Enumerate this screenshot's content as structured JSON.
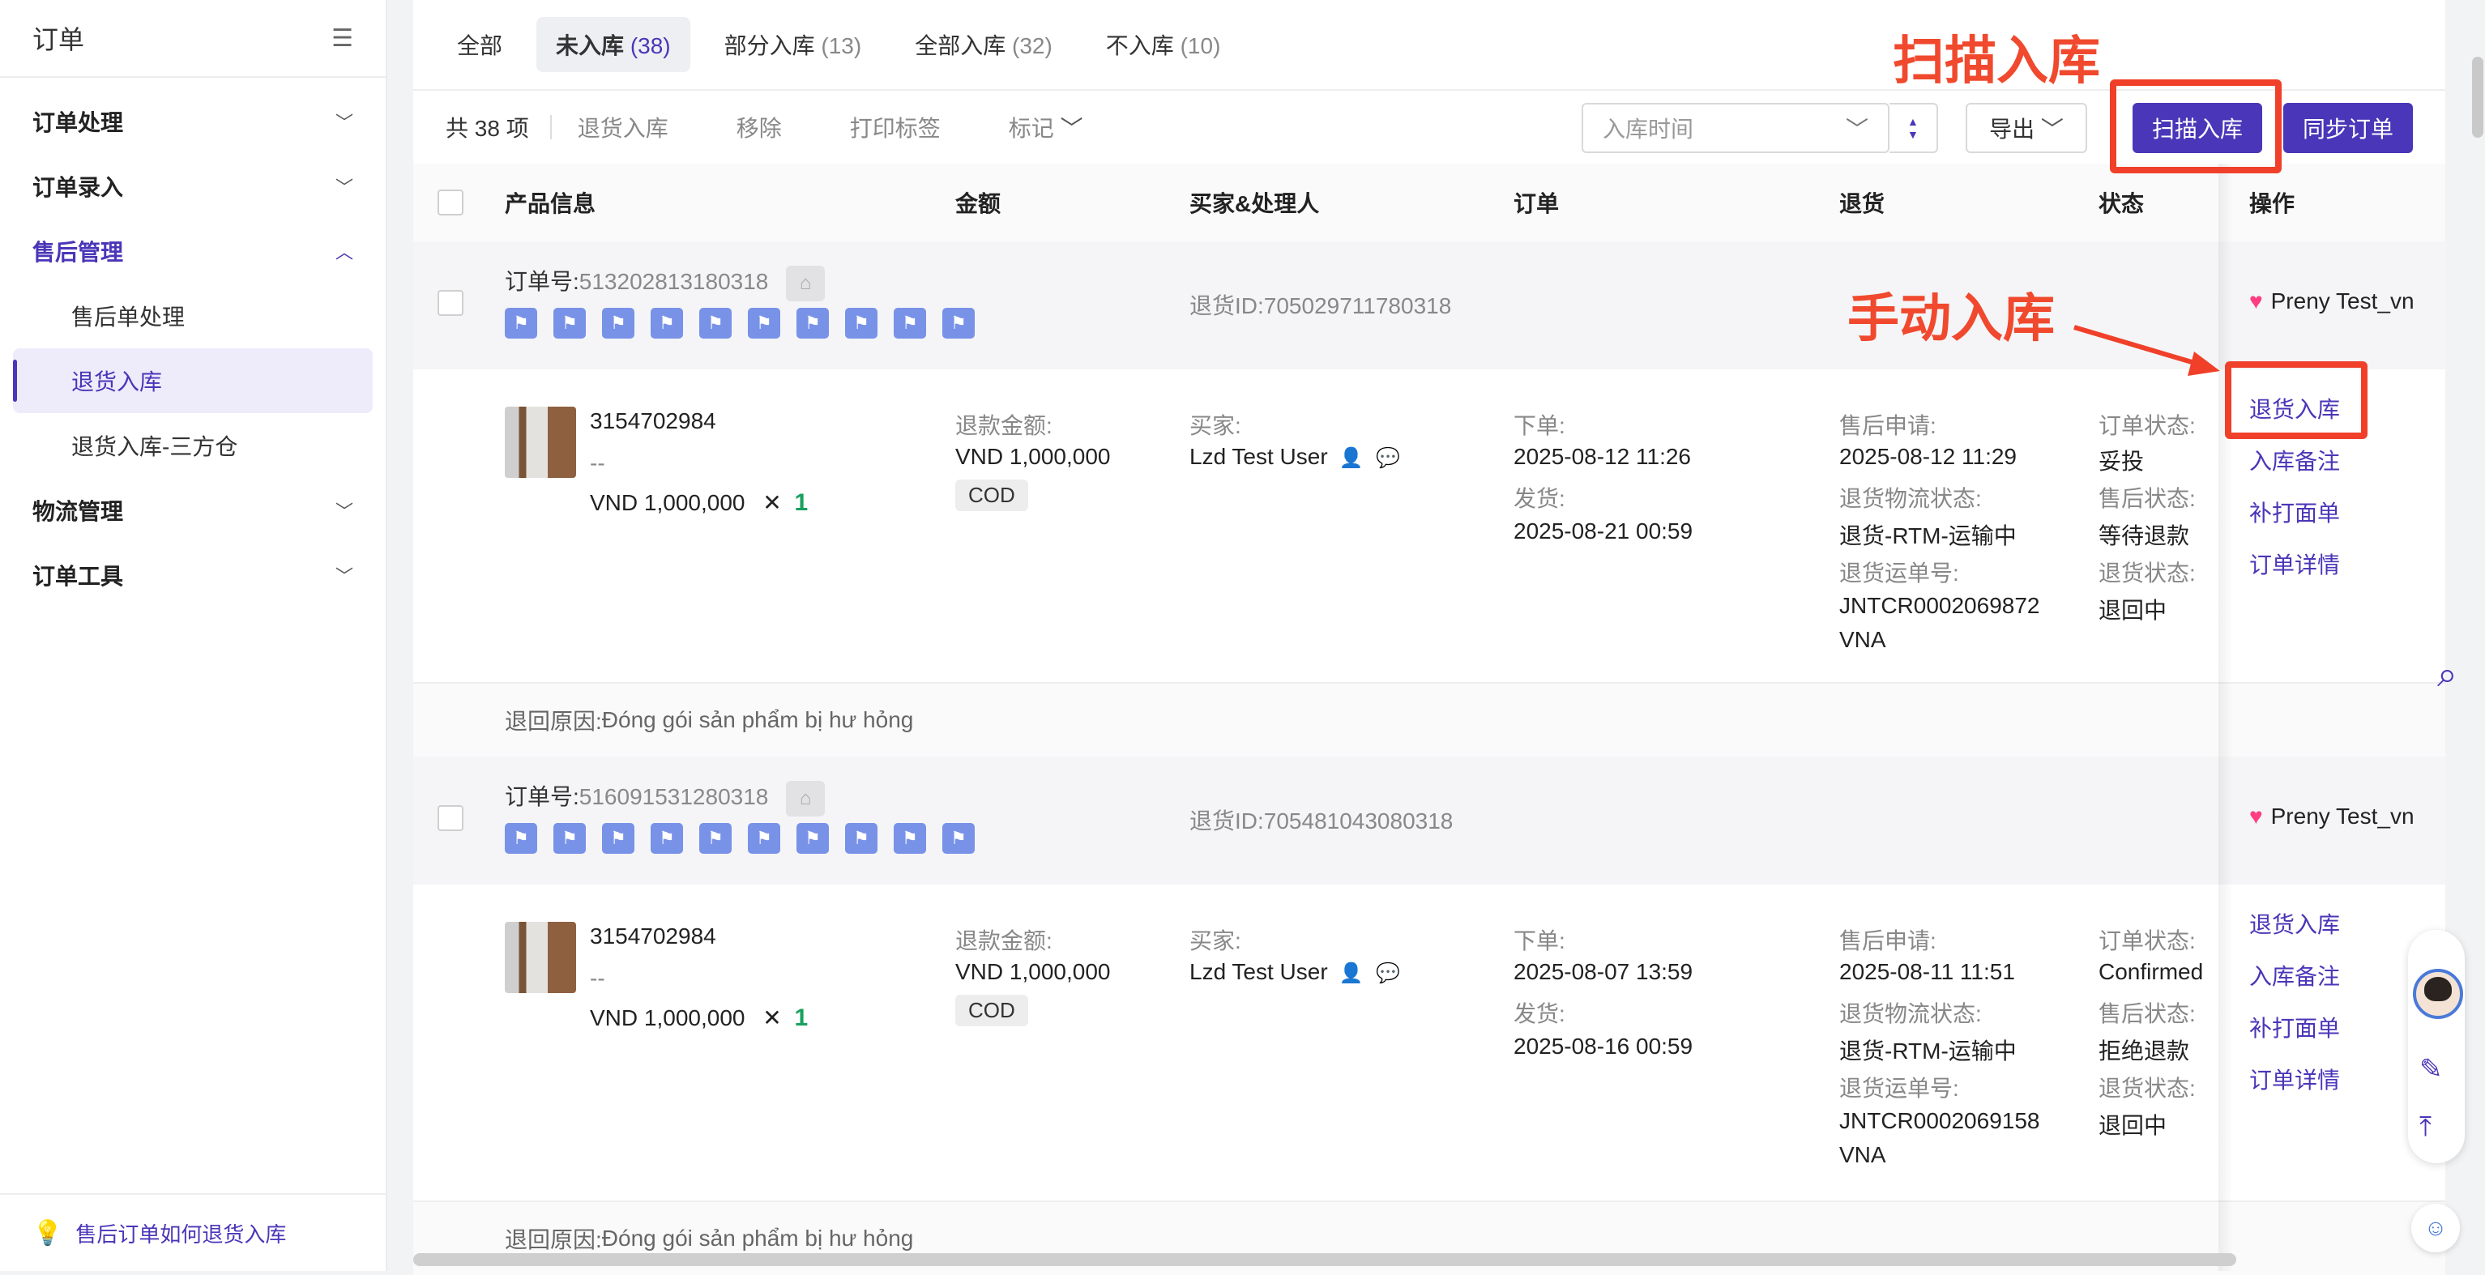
{
  "sidebar": {
    "title": "订单",
    "groups": [
      {
        "label": "订单处理"
      },
      {
        "label": "订单录入"
      },
      {
        "label": "售后管理"
      },
      {
        "label": "物流管理"
      },
      {
        "label": "订单工具"
      }
    ],
    "sub_items": [
      {
        "label": "售后单处理"
      },
      {
        "label": "退货入库"
      },
      {
        "label": "退货入库-三方仓"
      }
    ],
    "footer_link": "售后订单如何退货入库"
  },
  "tabs": [
    {
      "label": "全部",
      "count": ""
    },
    {
      "label": "未入库",
      "count": "(38)"
    },
    {
      "label": "部分入库",
      "count": "(13)"
    },
    {
      "label": "全部入库",
      "count": "(32)"
    },
    {
      "label": "不入库",
      "count": "(10)"
    }
  ],
  "toolbar": {
    "total": "共 38 项",
    "return_in": "退货入库",
    "remove": "移除",
    "print_label": "打印标签",
    "mark": "标记",
    "time_select": "入库时间",
    "export": "导出",
    "scan_in": "扫描入库",
    "sync": "同步订单"
  },
  "columns": {
    "product": "产品信息",
    "amount": "金额",
    "buyer": "买家&处理人",
    "order": "订单",
    "return": "退货",
    "status": "状态",
    "action": "操作"
  },
  "labels": {
    "order_no": "订单号:",
    "return_id": "退货ID:",
    "refund_amount": "退款金额:",
    "buyer": "买家:",
    "placed": "下单:",
    "shipped": "发货:",
    "aftersale_apply": "售后申请:",
    "return_logistics": "退货物流状态:",
    "return_tracking": "退货运单号:",
    "order_status": "订单状态:",
    "aftersale_status": "售后状态:",
    "return_status": "退货状态:",
    "reason": "退回原因:",
    "qty_x": "✕"
  },
  "orders": [
    {
      "order_no": "513202813180318",
      "return_id": "705029711780318",
      "store": "Preny Test_vn",
      "sku": "3154702984",
      "variant": "--",
      "price": "VND 1,000,000",
      "qty": "1",
      "refund": "VND 1,000,000",
      "pay_tag": "COD",
      "buyer": "Lzd Test User",
      "placed_time": "2025-08-12 11:26",
      "shipped_time": "2025-08-21 00:59",
      "apply_time": "2025-08-12 11:29",
      "logistics": "退货-RTM-运输中",
      "tracking_1": "JNTCR0002069872",
      "tracking_2": "VNA",
      "order_status": "妥投",
      "aftersale_status": "等待退款",
      "return_status": "退回中",
      "reason": "Đóng gói sản phẩm bị hư hỏng",
      "ops": [
        "退货入库",
        "入库备注",
        "补打面单",
        "订单详情"
      ]
    },
    {
      "order_no": "516091531280318",
      "return_id": "705481043080318",
      "store": "Preny Test_vn",
      "sku": "3154702984",
      "variant": "--",
      "price": "VND 1,000,000",
      "qty": "1",
      "refund": "VND 1,000,000",
      "pay_tag": "COD",
      "buyer": "Lzd Test User",
      "placed_time": "2025-08-07 13:59",
      "shipped_time": "2025-08-16 00:59",
      "apply_time": "2025-08-11 11:51",
      "logistics": "退货-RTM-运输中",
      "tracking_1": "JNTCR0002069158",
      "tracking_2": "VNA",
      "order_status": "Confirmed",
      "aftersale_status": "拒绝退款",
      "return_status": "退回中",
      "reason": "Đóng gói sản phẩm bị hư hỏng",
      "ops": [
        "退货入库",
        "入库备注",
        "补打面单",
        "订单详情"
      ]
    }
  ],
  "annotations": {
    "scan_title": "扫描入库",
    "manual_title": "手动入库"
  },
  "colors": {
    "brand": "#4a36b8",
    "annotation_red": "#f0402a",
    "flag_blue": "#7892e8",
    "qty_green": "#19a05f"
  },
  "icons": {
    "collapse": "collapse-sidebar-icon",
    "chevron": "chevron-down-icon",
    "flag": "flag-icon",
    "home": "home-icon",
    "heart": "lazada-heart-icon",
    "search": "search-icon",
    "bulb": "lightbulb-icon"
  }
}
